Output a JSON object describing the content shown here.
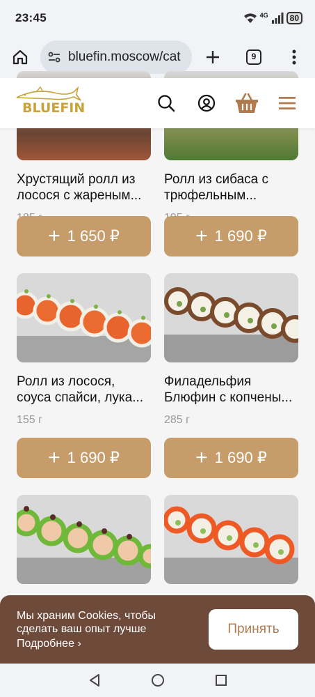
{
  "status_bar": {
    "time": "23:45",
    "network": "4G",
    "battery": "80"
  },
  "browser": {
    "url": "bluefin.moscow/cat",
    "tab_count": "9"
  },
  "site": {
    "logo_text": "BLUEFIN"
  },
  "products": [
    {
      "name": "Хрустящий ролл из лосося с жареным...",
      "weight": "185 г",
      "price": "1 650 ₽"
    },
    {
      "name": "Ролл из сибаса с трюфельным...",
      "weight": "195 г",
      "price": "1 690 ₽"
    },
    {
      "name": "Ролл из лосося, соуса спайси, лука...",
      "weight": "155 г",
      "price": "1 690 ₽"
    },
    {
      "name": "Филадельфия Блюфин с копчены...",
      "weight": "285 г",
      "price": "1 690 ₽"
    },
    {
      "name": "",
      "weight": "",
      "price": ""
    },
    {
      "name": "",
      "weight": "",
      "price": ""
    }
  ],
  "cookie_banner": {
    "text": "Мы храним Cookies, чтобы сделать ваш опыт лучше",
    "more_link": "Подробнее",
    "accept_label": "Принять"
  },
  "colors": {
    "accent": "#c69d6a",
    "cookie_bg": "#6d4a3a",
    "logo_gold": "#c9a23a"
  }
}
